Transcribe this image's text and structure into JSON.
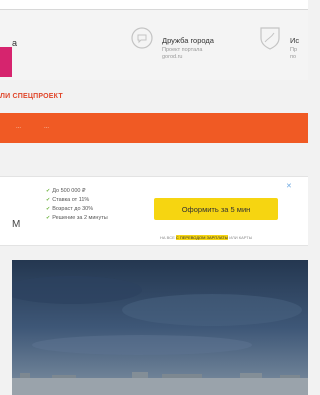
{
  "friends": {
    "left_label": "а",
    "cards": [
      {
        "title": "Дружба города",
        "subtitle_1": "Проект портала",
        "subtitle_2": "gorod.ru"
      },
      {
        "title": "Ис",
        "subtitle_1": "Пр",
        "subtitle_2": "по"
      }
    ]
  },
  "special_label": "ЛИ СПЕЦПРОЕКТ",
  "orange_nav": {
    "items": [
      "...",
      "..."
    ]
  },
  "ad": {
    "brand_fragment": "М",
    "bullets": [
      "До 500 000 ₽",
      "Ставка от 11%",
      "Возраст до 30%",
      "Решение за 2 минуты"
    ],
    "cta_label": "Оформить за 5 мин",
    "close_label": "✕",
    "fine_print_before": "НА ВСЕ ",
    "fine_print_highlight": "С ПЕРЕВОДОМ ЗАРПЛАТЫ",
    "fine_print_after": " ИЛИ КАРТЫ"
  },
  "colors": {
    "accent_orange": "#f05a24",
    "pink": "#d6246e",
    "cta_yellow": "#f6d511",
    "link_blue": "#6aa6e0"
  }
}
